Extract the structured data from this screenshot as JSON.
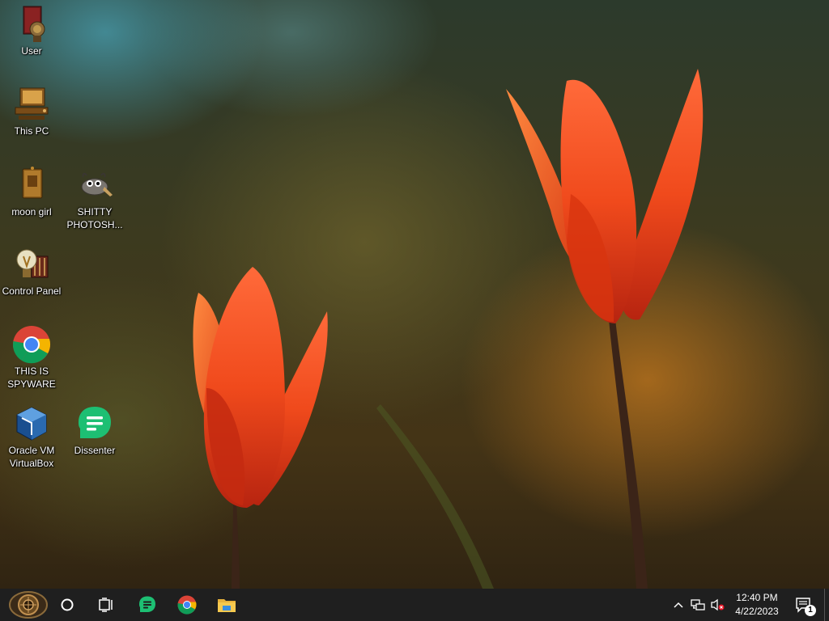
{
  "desktop": {
    "icons": [
      {
        "label": "User"
      },
      {
        "label": "This PC"
      },
      {
        "label": "moon girl"
      },
      {
        "label": "SHITTY PHOTOSH..."
      },
      {
        "label": "Control Panel"
      },
      {
        "label": "THIS IS SPYWARE"
      },
      {
        "label": "Oracle VM VirtualBox"
      },
      {
        "label": "Dissenter"
      }
    ]
  },
  "taskbar": {
    "pinned": [
      {
        "icon": "start-orb-icon"
      },
      {
        "icon": "cortana-circle-icon"
      },
      {
        "icon": "task-view-icon"
      },
      {
        "icon": "dissenter-icon"
      },
      {
        "icon": "chrome-icon"
      },
      {
        "icon": "file-explorer-icon"
      }
    ],
    "tray": {
      "time": "12:40 PM",
      "date": "4/22/2023",
      "notification_count": "1"
    }
  },
  "colors": {
    "taskbar_bg": "#1f1f1f",
    "dissenter_green": "#1dbf73"
  }
}
